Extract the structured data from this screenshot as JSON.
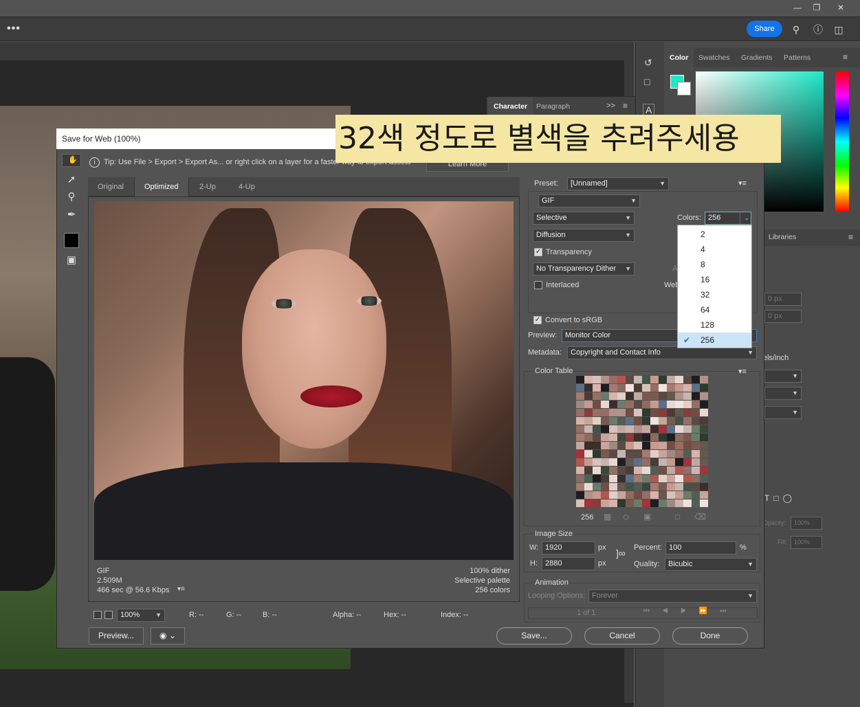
{
  "app": {
    "menubar_more": "•••",
    "share_label": "Share",
    "window_controls": [
      "minimize-icon",
      "restore-icon",
      "close-icon"
    ]
  },
  "annotation": "32색 정도로 별색을 추려주세용",
  "right_panel": {
    "tabs": [
      "Color",
      "Swatches",
      "Gradients",
      "Patterns"
    ],
    "foreground_color": "#1de9c8",
    "libraries_label": "Libraries",
    "px_fields": [
      "0 px",
      "0 px"
    ],
    "res_unit": "els/inch",
    "opacity_label": "Opacity:",
    "opacity_value": "100%",
    "fill_label": "Fill:",
    "fill_value": "100%"
  },
  "character_panel": {
    "tabs": [
      "Character",
      "Paragraph"
    ],
    "more": ">>"
  },
  "dialog": {
    "title": "Save for Web (100%)",
    "tip": "Tip: Use File > Export > Export As...  or right click on a layer for a faster way to export assets",
    "learn_more": "Learn More",
    "view_tabs": [
      "Original",
      "Optimized",
      "2-Up",
      "4-Up"
    ],
    "active_view": "Optimized",
    "image_info_left": [
      "GIF",
      "2.509M",
      "466 sec @ 56.6 Kbps"
    ],
    "image_info_menu": "▾≡",
    "image_info_right": [
      "100% dither",
      "Selective palette",
      "256 colors"
    ],
    "zoom": "100%",
    "status": {
      "r": "R: --",
      "g": "G: --",
      "b": "B: --",
      "alpha": "Alpha: --",
      "hex": "Hex: --",
      "index": "Index: --"
    },
    "preview_button": "Preview...",
    "save_button": "Save...",
    "cancel_button": "Cancel",
    "done_button": "Done",
    "settings": {
      "preset_label": "Preset:",
      "preset_value": "[Unnamed]",
      "format": "GIF",
      "reduction": "Selective",
      "dither_algorithm": "Diffusion",
      "transparency_label": "Transparency",
      "transparency_checked": true,
      "transparency_dither": "No Transparency Dither",
      "interlaced_label": "Interlaced",
      "interlaced_checked": false,
      "colors_label": "Colors:",
      "colors_value": "256",
      "web_label": "Web",
      "amount_partial": "A",
      "convert_srgb_label": "Convert to sRGB",
      "convert_srgb_checked": true,
      "preview_label": "Preview:",
      "preview_value": "Monitor Color",
      "metadata_label": "Metadata:",
      "metadata_value": "Copyright and Contact Info"
    },
    "colors_dropdown": {
      "options": [
        "2",
        "4",
        "8",
        "16",
        "32",
        "64",
        "128",
        "256"
      ],
      "selected": "256"
    },
    "color_table": {
      "label": "Color Table",
      "count": "256"
    },
    "image_size": {
      "label": "Image Size",
      "w_label": "W:",
      "w_value": "1920",
      "h_label": "H:",
      "h_value": "2880",
      "unit": "px",
      "percent_label": "Percent:",
      "percent_value": "100",
      "percent_unit": "%",
      "quality_label": "Quality:",
      "quality_value": "Bicubic"
    },
    "animation": {
      "label": "Animation",
      "looping_label": "Looping Options:",
      "looping_value": "Forever",
      "frame_counter": "1 of 1"
    }
  }
}
